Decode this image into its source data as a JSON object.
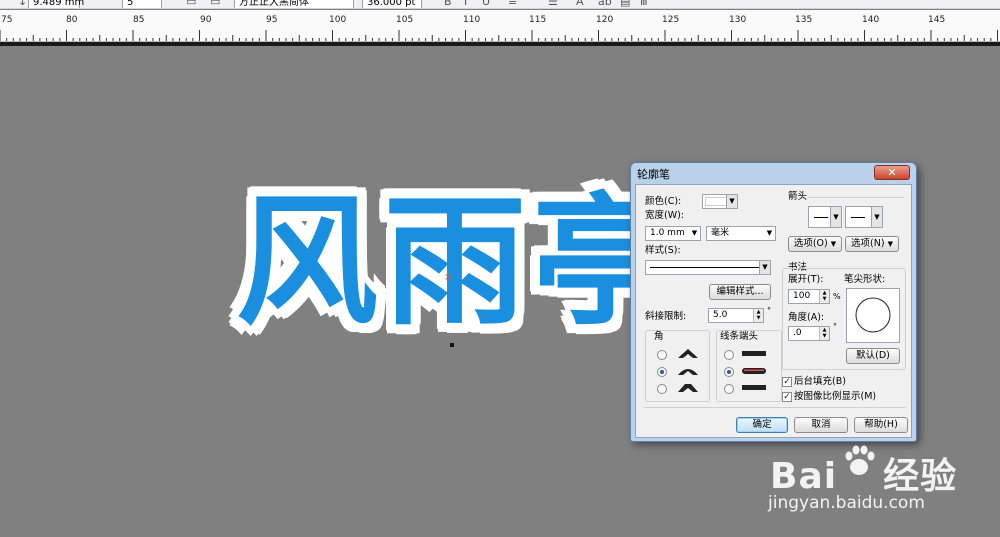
{
  "toolbar": {
    "coord_value": "9.489 mm",
    "small_value": "5",
    "font_name": "方正正大黑简体",
    "font_size": "36.000 pt"
  },
  "ruler": {
    "labels": [
      "75",
      "80",
      "85",
      "90",
      "95",
      "100",
      "105",
      "110",
      "115",
      "120",
      "125",
      "130",
      "135",
      "140",
      "145"
    ]
  },
  "canvas": {
    "background_color": "#808080",
    "artwork_text": [
      "风",
      "雨",
      "亭"
    ],
    "fill_color": "#1a8fe0",
    "outline_color": "#ffffff",
    "center_marker": "×"
  },
  "dialog": {
    "title": "轮廓笔",
    "close_glyph": "✕",
    "color_label": "颜色(C):",
    "width_label": "宽度(W):",
    "width_value": "1.0 mm",
    "unit_value": "毫米",
    "style_label": "样式(S):",
    "edit_style_button": "编辑样式...",
    "miter_label": "斜接限制:",
    "miter_value": "5.0",
    "miter_unit": "°",
    "corners_label": "角",
    "line_caps_label": "线条端头",
    "arrows_label": "箭头",
    "arrow_options_left": "选项(O)",
    "arrow_options_right": "选项(N)",
    "calligraphy_label": "书法",
    "stretch_label": "展开(T):",
    "stretch_value": "100",
    "stretch_unit": "%",
    "nib_shape_label": "笔尖形状:",
    "angle_label": "角度(A):",
    "angle_value": ".0",
    "angle_unit": "°",
    "default_button": "默认(D)",
    "behind_fill_label": "后台填充(B)",
    "behind_fill_checked": true,
    "scale_with_image_label": "按图像比例显示(M)",
    "scale_with_image_checked": true,
    "ok_button": "确定",
    "cancel_button": "取消",
    "help_button": "帮助(H)",
    "selected_corner_index": 1,
    "selected_cap_index": 1
  },
  "watermark": {
    "logo_text_left": "Bai",
    "logo_text_right": "经验",
    "url": "jingyan.baidu.com"
  }
}
